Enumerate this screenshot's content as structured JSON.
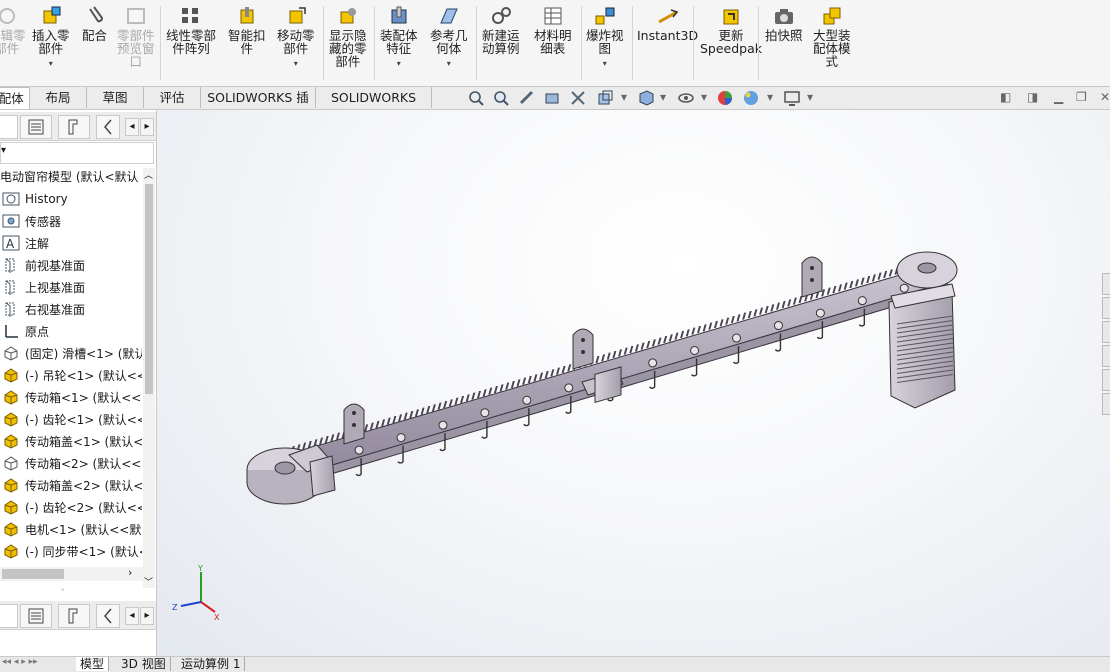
{
  "ribbon": {
    "buttons": [
      {
        "id": "edit-part",
        "label": "编辑零\n部件",
        "disabled": true
      },
      {
        "id": "insert-part",
        "label": "插入零\n部件",
        "disabled": false
      },
      {
        "id": "mate",
        "label": "配合",
        "disabled": false
      },
      {
        "id": "part-preview",
        "label": "零部件\n预览窗\n口",
        "disabled": true
      },
      {
        "id": "linear-pattern",
        "label": "线性零部\n件阵列",
        "disabled": false
      },
      {
        "id": "smart-fasteners",
        "label": "智能扣\n件",
        "disabled": false
      },
      {
        "id": "move-component",
        "label": "移动零\n部件",
        "disabled": false
      },
      {
        "id": "show-hidden",
        "label": "显示隐\n藏的零\n部件",
        "disabled": false
      },
      {
        "id": "assembly-features",
        "label": "装配体\n特征",
        "disabled": false
      },
      {
        "id": "reference-geometry",
        "label": "参考几\n何体",
        "disabled": false
      },
      {
        "id": "new-motion-study",
        "label": "新建运\n动算例",
        "disabled": false
      },
      {
        "id": "bom",
        "label": "材料明\n细表",
        "disabled": false
      },
      {
        "id": "exploded-view",
        "label": "爆炸视\n图",
        "disabled": false
      },
      {
        "id": "instant3d",
        "label": "Instant3D",
        "disabled": false
      },
      {
        "id": "update-speedpak",
        "label": "更新\nSpeedpak",
        "disabled": false
      },
      {
        "id": "snapshot",
        "label": "拍快照",
        "disabled": false
      },
      {
        "id": "large-assembly",
        "label": "大型装\n配体模\n式",
        "disabled": false
      }
    ]
  },
  "command_tabs": [
    "装配体",
    "布局",
    "草图",
    "评估",
    "SOLIDWORKS 插件",
    "SOLIDWORKS MBD"
  ],
  "feature_tree": {
    "root": "电动窗帘模型  (默认<默认",
    "items": [
      {
        "label": "History",
        "icon": "history-icon"
      },
      {
        "label": "传感器",
        "icon": "sensor-icon"
      },
      {
        "label": "注解",
        "icon": "annotation-icon"
      },
      {
        "label": "前视基准面",
        "icon": "plane-icon"
      },
      {
        "label": "上视基准面",
        "icon": "plane-icon"
      },
      {
        "label": "右视基准面",
        "icon": "plane-icon"
      },
      {
        "label": "原点",
        "icon": "origin-icon"
      },
      {
        "label": "(固定) 滑槽<1> (默认",
        "icon": "part-fixed-icon"
      },
      {
        "label": "(-) 吊轮<1> (默认<<",
        "icon": "part-icon"
      },
      {
        "label": "传动箱<1> (默认<<默",
        "icon": "part-icon"
      },
      {
        "label": "(-) 齿轮<1> (默认<<",
        "icon": "part-icon"
      },
      {
        "label": "传动箱盖<1> (默认<",
        "icon": "part-icon"
      },
      {
        "label": "传动箱<2> (默认<<默",
        "icon": "part-fixed-icon"
      },
      {
        "label": "传动箱盖<2> (默认<",
        "icon": "part-icon"
      },
      {
        "label": "(-) 齿轮<2> (默认<<",
        "icon": "part-icon"
      },
      {
        "label": "电机<1> (默认<<默认",
        "icon": "part-icon"
      },
      {
        "label": "(-) 同步带<1> (默认<",
        "icon": "part-icon"
      }
    ]
  },
  "triad": {
    "x": "X",
    "y": "Y",
    "z": "Z"
  },
  "bottom_tabs": [
    "模型",
    "3D 视图",
    "运动算例 1"
  ],
  "colors": {
    "accent": "#d9a400",
    "part_yellow": "#f0c000",
    "ribbon_bg": "#f5f5f5",
    "viewport_bg": "#eef1f5"
  }
}
